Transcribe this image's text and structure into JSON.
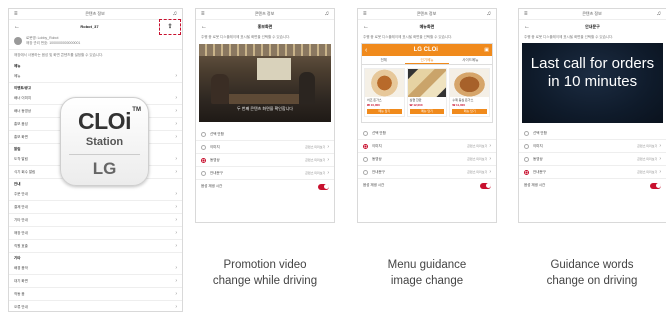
{
  "phone1": {
    "status_title": "콘텐츠 정보",
    "nav_title": "Robot_37",
    "robot_name": "로봇명: Lobby_Robot",
    "robot_sub": "매장 관리 번호: 1000000000000001",
    "info_text": "매장에서 사용하는 음성 및 화면 콘텐츠를 설정할 수 있습니다.",
    "section1": "메뉴",
    "row1": "메뉴",
    "section2": "이벤트/광고",
    "rows_a": [
      "배너 이미지",
      "배너 동영상",
      "홍보 음성",
      "홍보 화면"
    ],
    "section3": "알림",
    "rows_b": [
      "도착 알림",
      "식기 회수 알림"
    ],
    "section4": "안내",
    "rows_c": [
      "주문 안내",
      "결제 안내",
      "기타 안내",
      "매장 안내",
      "직원 호출"
    ],
    "section5": "기타",
    "rows_d": [
      "배경 음악",
      "대기 화면",
      "작동 음",
      "오류 안내",
      "기타 설정"
    ]
  },
  "logo": {
    "brand": "CLOi",
    "tm": "TM",
    "product": "Station",
    "maker": "LG"
  },
  "phone2": {
    "status_title": "콘텐츠 정보",
    "nav_title": "홍보화면",
    "info_text": "주행 중 로봇 디스플레이에 표시될 화면을 선택할 수 있습니다.",
    "video_text": "두 번째 콘텐츠 화면을 확인합니다",
    "options": [
      {
        "label": "선택 안함",
        "value": ""
      },
      {
        "label": "이미지",
        "value": "콘텐츠 미리보기"
      },
      {
        "label": "동영상",
        "value": "콘텐츠 미리보기"
      },
      {
        "label": "안내문구",
        "value": "콘텐츠 미리보기"
      }
    ],
    "toggle_label": "음성 재생 시간"
  },
  "phone3": {
    "status_title": "콘텐츠 정보",
    "nav_title": "메뉴화면",
    "info_text": "주행 중 로봇 디스플레이에 표시될 화면을 선택할 수 있습니다.",
    "banner_title": "LG CLOi",
    "tabs": [
      "전체",
      "인기메뉴",
      "사이드메뉴"
    ],
    "foods": [
      {
        "name": "치즈 돈가스",
        "price": "₩ 10,000",
        "btn": "메뉴 담기"
      },
      {
        "name": "삼겹 한판",
        "price": "₩ 12,000",
        "btn": "메뉴 담기"
      },
      {
        "name": "수제 등심 돈가스",
        "price": "₩ 11,000",
        "btn": "메뉴 담기"
      }
    ],
    "options": [
      {
        "label": "선택 안함",
        "value": ""
      },
      {
        "label": "이미지",
        "value": "콘텐츠 미리보기"
      },
      {
        "label": "동영상",
        "value": "콘텐츠 미리보기"
      },
      {
        "label": "안내문구",
        "value": "콘텐츠 미리보기"
      }
    ],
    "toggle_label": "음성 재생 시간"
  },
  "phone4": {
    "status_title": "콘텐츠 정보",
    "nav_title": "안내문구",
    "info_text": "주행 중 로봇 디스플레이에 표시될 화면을 선택할 수 있습니다.",
    "screen_line1": "Last call for orders",
    "screen_line2": "in 10 minutes",
    "options": [
      {
        "label": "선택 안함",
        "value": ""
      },
      {
        "label": "이미지",
        "value": "콘텐츠 미리보기"
      },
      {
        "label": "동영상",
        "value": "콘텐츠 미리보기"
      },
      {
        "label": "안내문구",
        "value": "콘텐츠 미리보기"
      }
    ],
    "toggle_label": "음성 재생 시간"
  },
  "captions": {
    "c1_line1": "Promotion video",
    "c1_line2": "change while driving",
    "c2_line1": "Menu guidance",
    "c2_line2": "image change",
    "c3_line1": "Guidance words",
    "c3_line2": "change on driving"
  },
  "colors": {
    "accent_red": "#c8102e",
    "banner_orange": "#f08a1c",
    "screen_navy": "#0f1b2b"
  }
}
